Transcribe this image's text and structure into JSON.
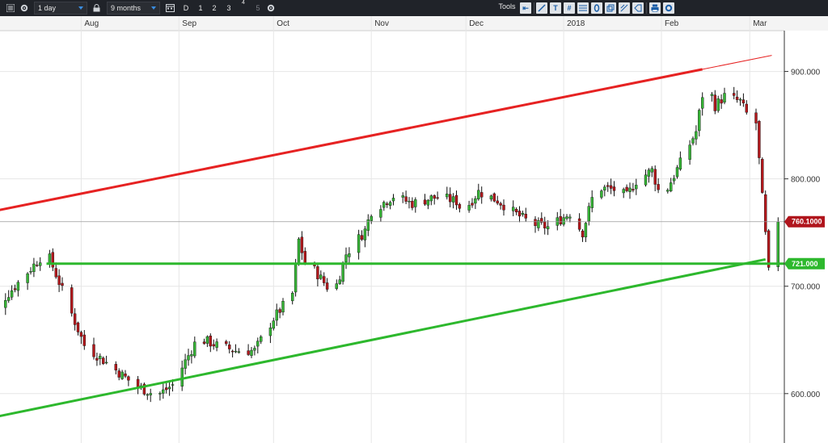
{
  "toolbar": {
    "interval": "1 day",
    "range": "9 months",
    "tf_buttons": [
      "D",
      "1",
      "2",
      "3",
      "4",
      "5"
    ],
    "tools_label": "Tools"
  },
  "chart_data": {
    "type": "candlestick",
    "x_axis_months": [
      {
        "label": "Aug",
        "day": 31
      },
      {
        "label": "Sep",
        "day": 62
      },
      {
        "label": "Oct",
        "day": 92
      },
      {
        "label": "Nov",
        "day": 123
      },
      {
        "label": "Dec",
        "day": 153
      },
      {
        "label": "2018",
        "day": 184
      },
      {
        "label": "Feb",
        "day": 215
      },
      {
        "label": "Mar",
        "day": 243
      }
    ],
    "y_ticks": [
      {
        "value": 900,
        "label": "900.000"
      },
      {
        "value": 800,
        "label": "800.000"
      },
      {
        "value": 700,
        "label": "700.000"
      },
      {
        "value": 600,
        "label": "600.000"
      }
    ],
    "ylim": [
      554,
      938
    ],
    "last_price": {
      "value": 760.1,
      "label": "760.1000",
      "color": "#b0141c"
    },
    "level_line": {
      "value": 721,
      "label": "721.000",
      "color": "#2db82d"
    },
    "resistance_line": {
      "start": [
        0,
        768
      ],
      "end": [
        228,
        902
      ],
      "extend_to": [
        250,
        915
      ],
      "color": "#e62222"
    },
    "support_line": {
      "start": [
        0,
        576
      ],
      "end": [
        248,
        725
      ],
      "color": "#2db82d"
    },
    "up_color": "#36b336",
    "down_color": "#b3181c",
    "grid": true
  }
}
